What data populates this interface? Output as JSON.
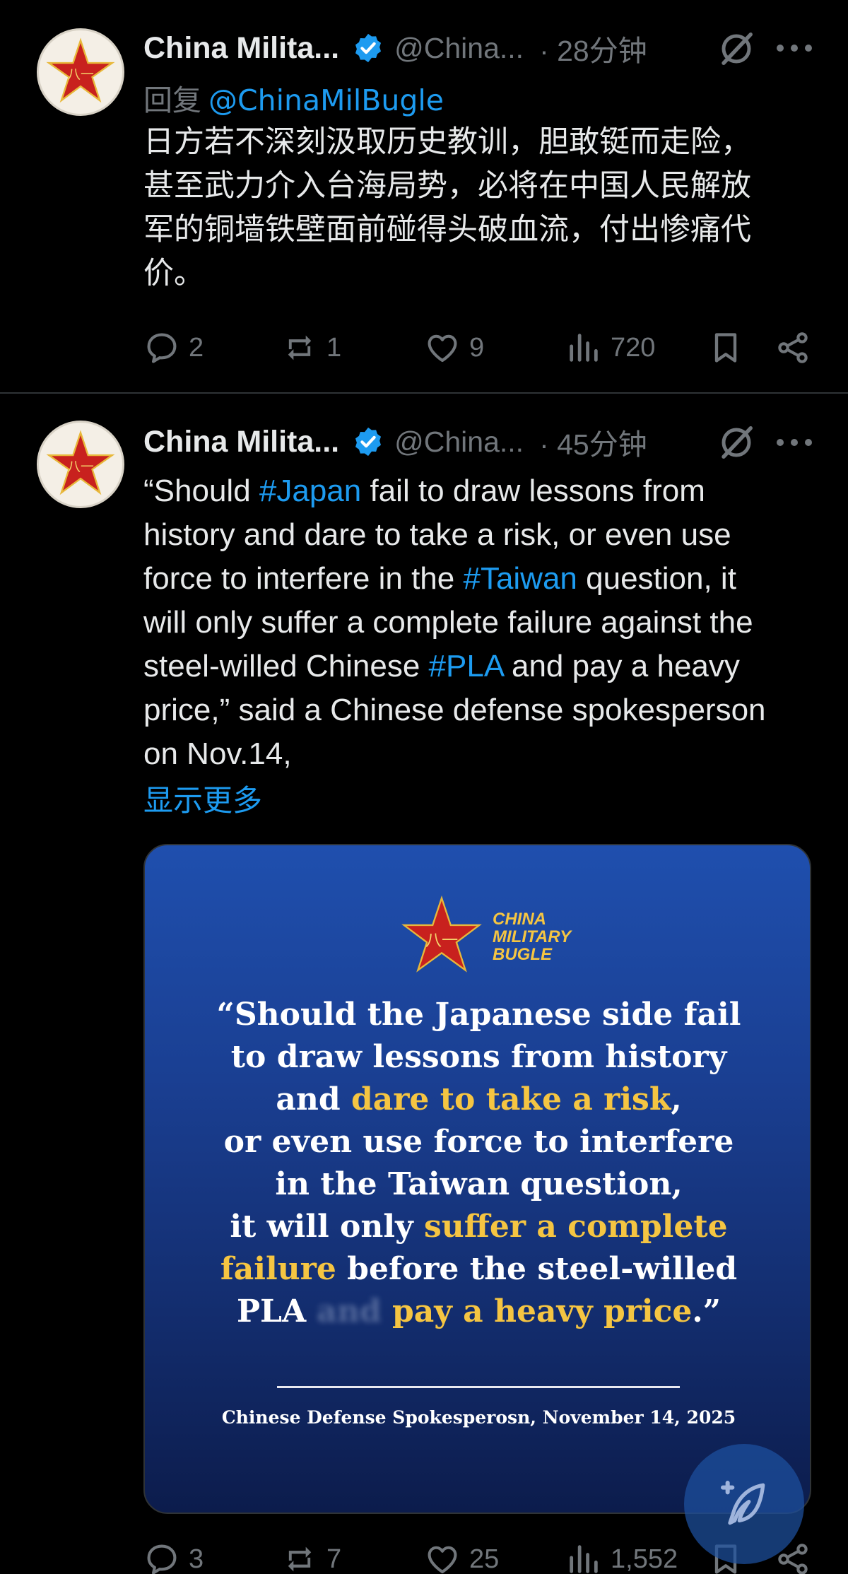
{
  "tweets": [
    {
      "author_name": "China Milita...",
      "handle": "@China...",
      "time": "· 28分钟",
      "reply_prefix": "回复",
      "reply_mention": "@ChinaMilBugle",
      "text_lines": [
        "日方若不深刻汲取历史教训，胆敢铤而走险，",
        "甚至武力介入台海局势，必将在中国人民解放",
        "军的铜墙铁壁面前碰得头破血流，付出惨痛代",
        "价。"
      ],
      "stats": {
        "replies": "2",
        "reposts": "1",
        "likes": "9",
        "views": "720"
      }
    },
    {
      "author_name": "China Milita...",
      "handle": "@China...",
      "time": "· 45分钟",
      "text_lines": [
        [
          {
            "t": "“Should "
          },
          {
            "t": "#Japan",
            "tag": true
          },
          {
            "t": " fail to draw lessons from"
          }
        ],
        [
          {
            "t": "history and dare to take a risk, or even use"
          }
        ],
        [
          {
            "t": "force to interfere in the "
          },
          {
            "t": "#Taiwan",
            "tag": true
          },
          {
            "t": " question, it"
          }
        ],
        [
          {
            "t": "will only suffer a complete failure against the"
          }
        ],
        [
          {
            "t": "steel-willed Chinese "
          },
          {
            "t": "#PLA",
            "tag": true
          },
          {
            "t": " and pay a heavy"
          }
        ],
        [
          {
            "t": "price,” said a Chinese defense spokesperson"
          }
        ],
        [
          {
            "t": "on Nov.14,"
          }
        ]
      ],
      "show_more": "显示更多",
      "image": {
        "logo_text": [
          "CHINA",
          "MILITARY",
          "BUGLE"
        ],
        "quote_lines": [
          [
            {
              "t": "“Should the Japanese side fail"
            }
          ],
          [
            {
              "t": "to draw lessons from history"
            }
          ],
          [
            {
              "t": "and "
            },
            {
              "t": "dare to take a risk",
              "hl": true
            },
            {
              "t": ","
            }
          ],
          [
            {
              "t": "or even use force to interfere"
            }
          ],
          [
            {
              "t": "in the Taiwan question,"
            }
          ],
          [
            {
              "t": "it will only "
            },
            {
              "t": "suffer a complete",
              "hl": true
            }
          ],
          [
            {
              "t": "failure",
              "hl": true
            },
            {
              "t": " before the steel-willed"
            }
          ],
          [
            {
              "t": "PLA "
            },
            {
              "t": "and",
              "blur": true
            },
            {
              "t": " "
            },
            {
              "t": "pay a heavy price",
              "hl": true
            },
            {
              "t": ".”"
            }
          ]
        ],
        "attribution": "Chinese Defense Spokesperosn, November 14, 2025"
      },
      "stats": {
        "replies": "3",
        "reposts": "7",
        "likes": "25",
        "views": "1,552"
      }
    }
  ],
  "colors": {
    "accent": "#1d9bf0",
    "muted": "#71767b",
    "highlight": "#f5c542",
    "background": "#000000"
  }
}
